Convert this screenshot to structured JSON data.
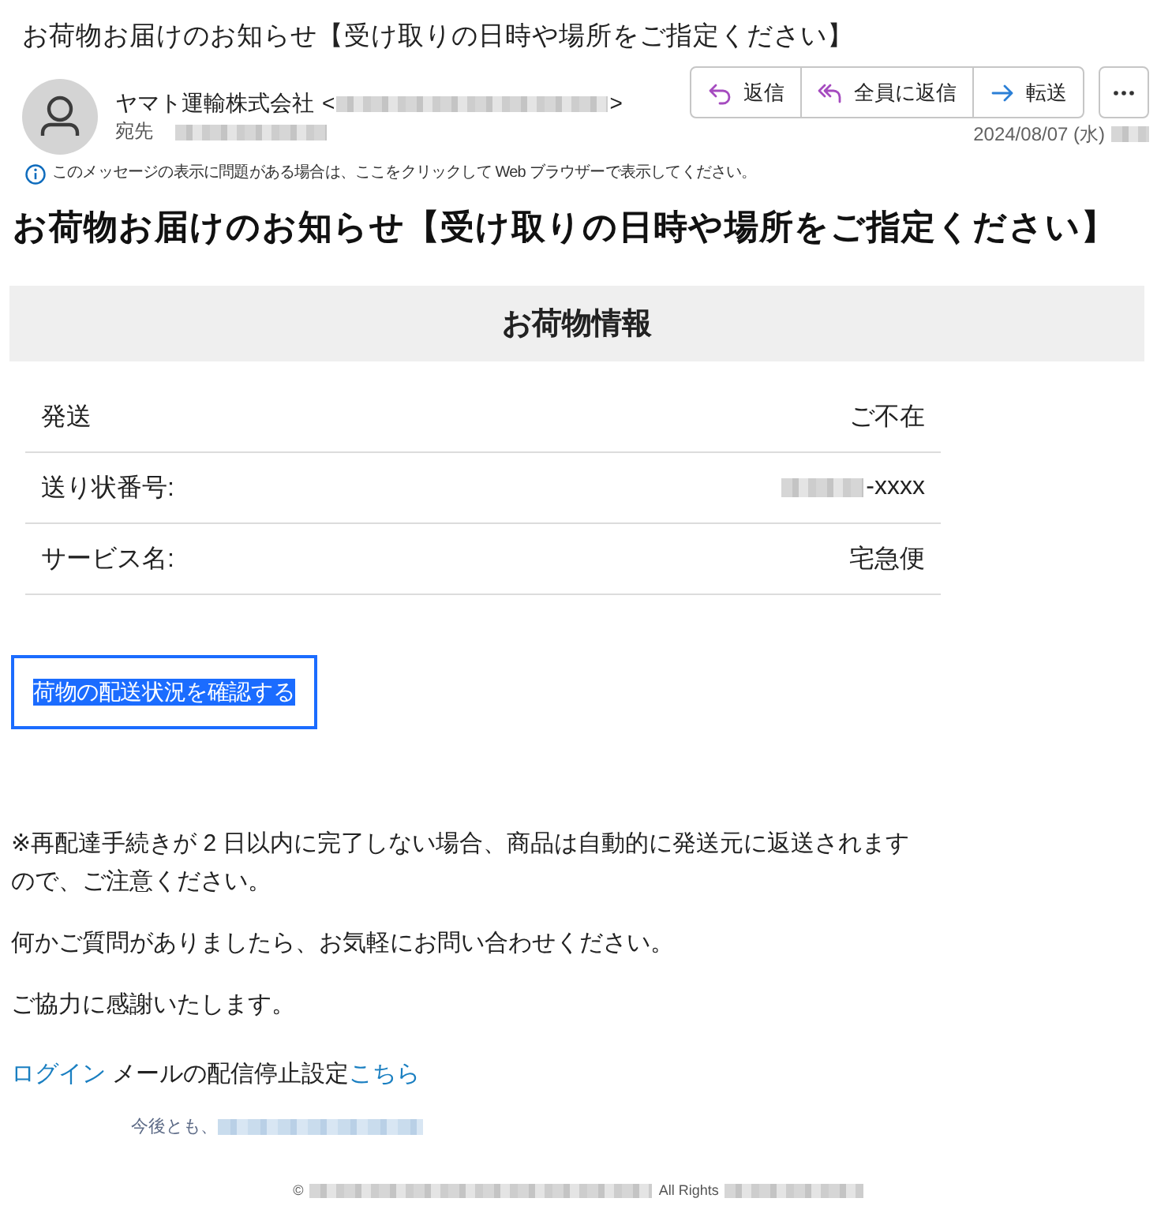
{
  "message": {
    "subject": "お荷物お届けのお知らせ【受け取りの日時や場所をご指定ください】",
    "sender": {
      "name": "ヤマト運輸株式会社",
      "open_bracket": "<",
      "close_bracket": ">"
    },
    "recipient_label": "宛先",
    "actions": [
      {
        "kind": "reply",
        "label": "返信"
      },
      {
        "kind": "reply-all",
        "label": "全員に返信"
      },
      {
        "kind": "forward",
        "label": "転送"
      }
    ],
    "date": "2024/08/07 (水)",
    "info_bar": "このメッセージの表示に問題がある場合は、ここをクリックして Web ブラウザーで表示してください。"
  },
  "body": {
    "heading": "お荷物お届けのお知らせ【受け取りの日時や場所をご指定ください】",
    "section_title": "お荷物情報",
    "rows": [
      {
        "label": "発送",
        "value": "ご不在",
        "masked": false
      },
      {
        "label": "送り状番号:",
        "value": "-xxxx",
        "masked": true
      },
      {
        "label": "サービス名:",
        "value": "宅急便",
        "masked": false
      }
    ],
    "track_button": {
      "label": "荷物の配送状況を確認する",
      "highlighted": true
    },
    "paragraphs": [
      "※再配達手続きが 2 日以内に完了しない場合、商品は自動的に発送元に返送されますので、ご注意ください。",
      "何かご質問がありましたら、お気軽にお問い合わせください。",
      "ご協力に感謝いたします。"
    ],
    "login_link": "ログイン",
    "unsubscribe_text": "メールの配信停止設定",
    "unsubscribe_link": "こちら",
    "closing": "今後とも、",
    "footer": {
      "copyright": "©",
      "rights": "All Rights"
    }
  }
}
